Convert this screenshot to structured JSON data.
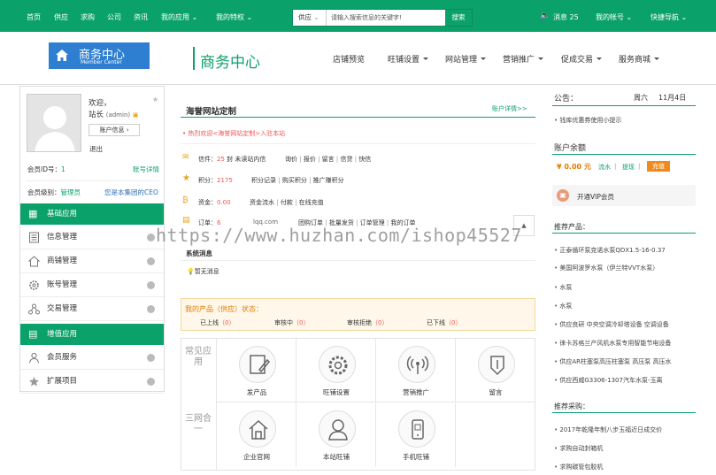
{
  "topbar": {
    "links": [
      "首页",
      "供应",
      "求购",
      "公司",
      "资讯"
    ],
    "my_apps": "我的应用",
    "privileges": "我的特权",
    "search_select": "供应",
    "search_placeholder": "请输入搜索信息的关键字!",
    "search_button": "搜索",
    "messages_label": "消息",
    "messages_count": "25",
    "my_account": "我的帐号",
    "quick_nav": "快捷导航"
  },
  "header": {
    "logo_title": "商务中心",
    "logo_sub": "Member Center",
    "page_title": "商务中心",
    "nav": [
      "店铺预览",
      "旺铺设置",
      "网站管理",
      "营销推广",
      "促成交易",
      "服务商城"
    ]
  },
  "profile": {
    "welcome": "欢迎，",
    "user": "站长",
    "user_tag": "(admin)",
    "account_info_btn": "账户信息",
    "logout": "退出",
    "member_id_label": "会员ID号：",
    "member_id": "1",
    "account_detail": "账号详情",
    "member_level_label": "会员级别：",
    "member_level": "管理员",
    "ceo_note": "您是本集团的CEO"
  },
  "sidebar": {
    "section1": "基础应用",
    "items1": [
      "信息管理",
      "商铺管理",
      "账号管理",
      "交易管理"
    ],
    "section2": "增值应用",
    "items2": [
      "会员服务",
      "扩展项目"
    ]
  },
  "main": {
    "title": "海誉网站定制",
    "account_detail_link": "账户详情>>",
    "welcome_text": "热烈欢迎<海誉网站定制>入驻本站",
    "letter_label": "信件：",
    "letter_count": "25",
    "letter_unread": "封 未读站内信",
    "letter_links": [
      "询价",
      "报价",
      "留言",
      "信贷",
      "快信"
    ],
    "points_label": "积分：",
    "points_value": "2175",
    "points_links": [
      "积分记录",
      "购买积分",
      "推广赚积分"
    ],
    "funds_label": "资金：",
    "funds_value": "0.00",
    "funds_links": [
      "资金流水",
      "付款",
      "在线充值"
    ],
    "orders_label": "订单：",
    "orders_value": "6",
    "orders_extra": "lqq.com",
    "orders_links": [
      "团购订单",
      "批量发货",
      "订单管理",
      "我的订单"
    ],
    "sys_msg_title": "系统消息",
    "sys_msg_empty": "暂无消息",
    "products_title": "我的产品（供应）状态：",
    "product_status": [
      {
        "label": "已上线",
        "count": "（0）"
      },
      {
        "label": "审核中",
        "count": "（0）"
      },
      {
        "label": "审核拒绝",
        "count": "（0）"
      },
      {
        "label": "已下线",
        "count": "（0）"
      }
    ],
    "common_apps_label": "常见应用",
    "common_apps": [
      "发产品",
      "旺铺设置",
      "营销推广",
      "留言"
    ],
    "three_nets_label": "三网合一",
    "three_nets": [
      "企业官网",
      "本站旺铺",
      "手机旺铺"
    ]
  },
  "right": {
    "notice_title": "公告：",
    "weekday": "周六",
    "date": "11月4日",
    "notice_item": "钱库优惠券使用小提示",
    "balance_title": "账户余额",
    "balance": "¥ 0.00 元",
    "flow": "流水",
    "withdraw": "提现",
    "recharge": "充值",
    "vip": "开通VIP会员",
    "recommend_title": "推荐产品：",
    "recommend": [
      "正泰循环泵克诺水泵QDX1.5-16-0.37",
      "美国阿波罗水泵（伊兰特VVT水泵）",
      "水泵",
      "水泵",
      "供应良研 中央空调冷却塔设备 空调设备",
      "徕卡苏格兰产风机水泵专用智能节电设备",
      "供应AR柱塞泵高压柱塞泵 高压泵 高压水",
      "供应西威G3306-1307汽车水泵-玉离"
    ],
    "purchase_title": "推荐采购：",
    "purchase": [
      "2017年乾隆年制八步玉福近日成交价",
      "求购自动封箱机",
      "求购碳管包胶机"
    ]
  },
  "watermark": "https://www.huzhan.com/ishop45527",
  "colors": {
    "brand_green": "#0aa26a",
    "logo_blue": "#2e7fd1",
    "recharge_orange": "#f08a1e"
  }
}
